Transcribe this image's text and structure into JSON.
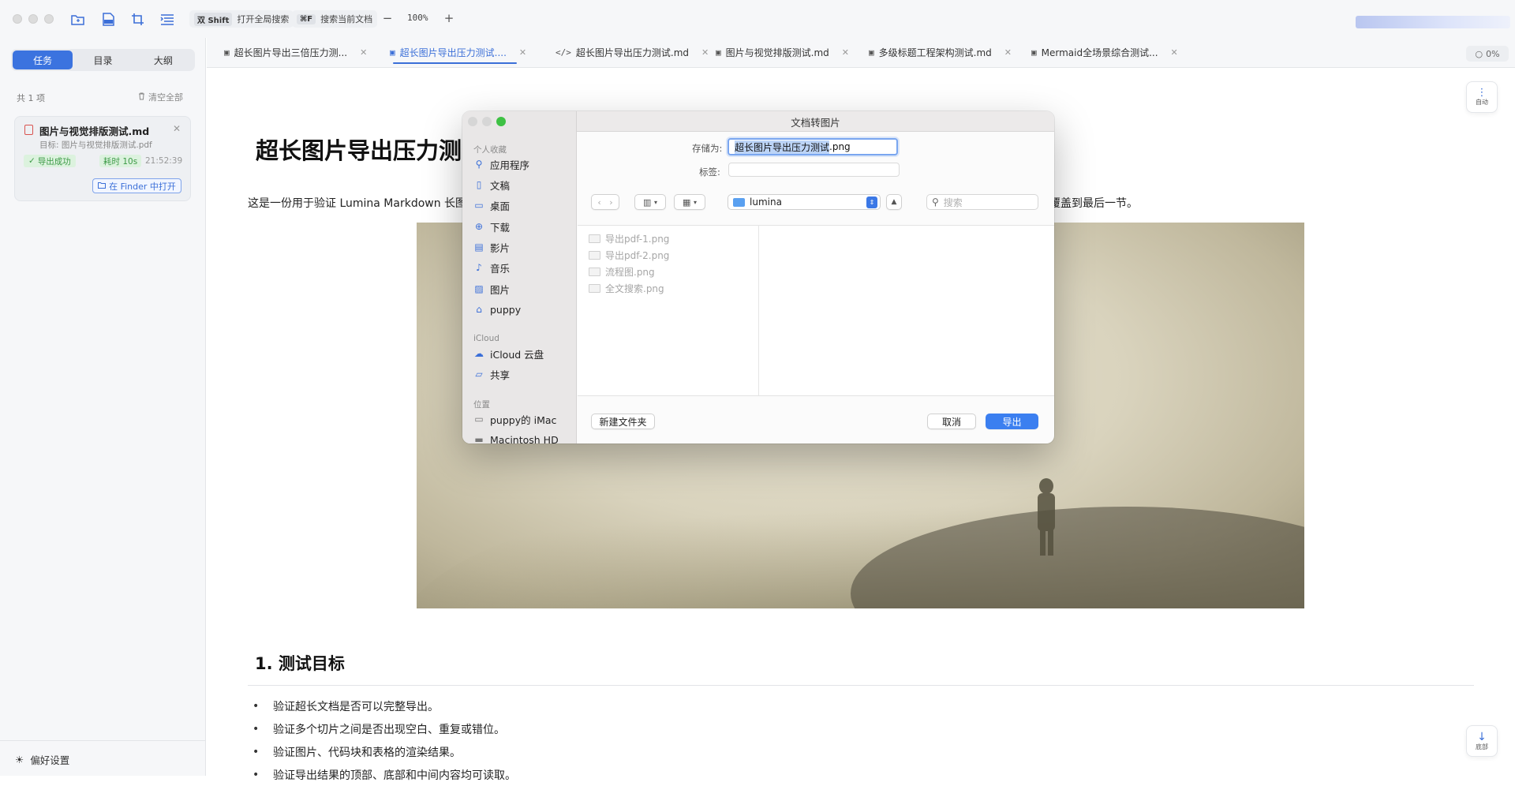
{
  "titlebar": {
    "shortcut_global": {
      "keys": "双 Shift",
      "label": "打开全局搜索"
    },
    "shortcut_doc": {
      "keys": "⌘F",
      "label": "搜索当前文档"
    },
    "zoom_out": "−",
    "zoom_value": "100%",
    "zoom_in": "+"
  },
  "sidebar": {
    "tabs": [
      "任务",
      "目录",
      "大纲"
    ],
    "count_label": "共 1 项",
    "clear_all": "清空全部",
    "task": {
      "title": "图片与视觉排版测试.md",
      "target": "目标:  图片与视觉排版测试.pdf",
      "status": "导出成功",
      "duration": "耗时 10s",
      "time": "21:52:39",
      "finder_button": "在 Finder 中打开"
    },
    "preferences": "偏好设置"
  },
  "tabs": [
    {
      "label": "超长图片导出三倍压力测...",
      "icon": "document-image-icon"
    },
    {
      "label": "超长图片导出压力测试....",
      "icon": "document-image-icon",
      "active": true
    },
    {
      "label": "超长图片导出压力测试.md",
      "icon": "code-icon"
    },
    {
      "label": "图片与视觉排版测试.md",
      "icon": "document-image-icon"
    },
    {
      "label": "多级标题工程架构测试.md",
      "icon": "document-image-icon"
    },
    {
      "label": "Mermaid全场景综合测试...",
      "icon": "document-image-icon"
    }
  ],
  "progress_chip": "0%",
  "document": {
    "title": "超长图片导出压力测",
    "intro_left": "这是一份用于验证 Lumina Markdown 长图",
    "intro_right": "覆盖到最后一节。",
    "section_title": "1. 测试目标",
    "bullets": [
      "验证超长文档是否可以完整导出。",
      "验证多个切片之间是否出现空白、重复或错位。",
      "验证图片、代码块和表格的渲染结果。",
      "验证导出结果的顶部、底部和中间内容均可读取。"
    ]
  },
  "float_buttons": {
    "auto": "自动",
    "bottom": "底部"
  },
  "dialog": {
    "title": "文档转图片",
    "save_as_label": "存储为:",
    "save_as_value_selected": "超长图片导出压力测试",
    "save_as_value_ext": ".png",
    "tags_label": "标签:",
    "folder": "lumina",
    "search_placeholder": "搜索",
    "sidebar": {
      "favorites_header": "个人收藏",
      "favorites": [
        "应用程序",
        "文稿",
        "桌面",
        "下载",
        "影片",
        "音乐",
        "图片",
        "puppy"
      ],
      "icloud_header": "iCloud",
      "icloud": [
        "iCloud 云盘",
        "共享"
      ],
      "locations_header": "位置",
      "locations": [
        "puppy的 iMac",
        "Macintosh HD"
      ]
    },
    "files": [
      "导出pdf-1.png",
      "导出pdf-2.png",
      "流程图.png",
      "全文搜索.png"
    ],
    "new_folder": "新建文件夹",
    "cancel": "取消",
    "export": "导出"
  },
  "colors": {
    "accent": "#3b73df",
    "success": "#3c9a46",
    "export_button": "#3b7ff0"
  }
}
